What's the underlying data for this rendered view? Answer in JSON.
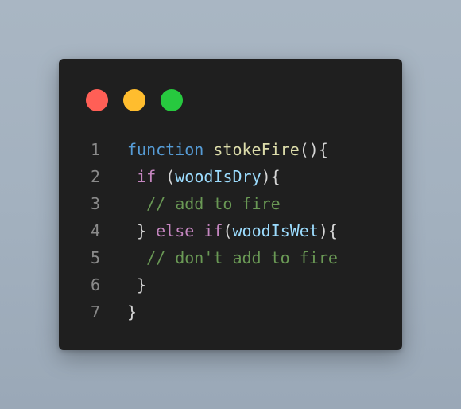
{
  "window": {
    "controls": [
      {
        "name": "close",
        "color": "#ff5f56"
      },
      {
        "name": "minimize",
        "color": "#ffbd2e"
      },
      {
        "name": "maximize",
        "color": "#27c93f"
      }
    ]
  },
  "code": {
    "lines": [
      {
        "num": "1",
        "indent": "",
        "tokens": [
          {
            "t": "function",
            "c": "kw-fn"
          },
          {
            "t": " ",
            "c": "pn"
          },
          {
            "t": "stokeFire",
            "c": "fn"
          },
          {
            "t": "(){",
            "c": "pn"
          }
        ]
      },
      {
        "num": "2",
        "indent": " ",
        "tokens": [
          {
            "t": "if",
            "c": "kw"
          },
          {
            "t": " (",
            "c": "pn"
          },
          {
            "t": "woodIsDry",
            "c": "var"
          },
          {
            "t": "){",
            "c": "pn"
          }
        ]
      },
      {
        "num": "3",
        "indent": "  ",
        "tokens": [
          {
            "t": "// add to fire",
            "c": "cm"
          }
        ]
      },
      {
        "num": "4",
        "indent": " ",
        "tokens": [
          {
            "t": "} ",
            "c": "pn"
          },
          {
            "t": "else",
            "c": "kw"
          },
          {
            "t": " ",
            "c": "pn"
          },
          {
            "t": "if",
            "c": "kw"
          },
          {
            "t": "(",
            "c": "pn"
          },
          {
            "t": "woodIsWet",
            "c": "var"
          },
          {
            "t": "){",
            "c": "pn"
          }
        ]
      },
      {
        "num": "5",
        "indent": "  ",
        "tokens": [
          {
            "t": "// don't add to fire",
            "c": "cm"
          }
        ]
      },
      {
        "num": "6",
        "indent": " ",
        "tokens": [
          {
            "t": "}",
            "c": "pn"
          }
        ]
      },
      {
        "num": "7",
        "indent": "",
        "tokens": [
          {
            "t": "}",
            "c": "pn"
          }
        ]
      }
    ]
  }
}
